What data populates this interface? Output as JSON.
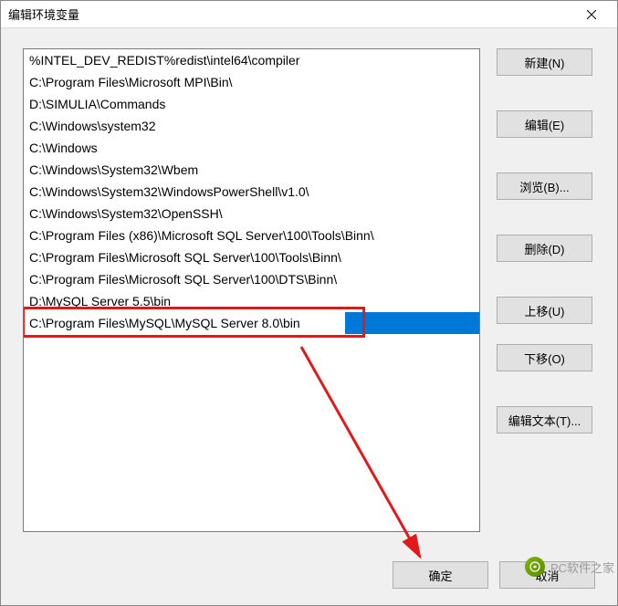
{
  "window": {
    "title": "编辑环境变量"
  },
  "list": {
    "items": [
      "%INTEL_DEV_REDIST%redist\\intel64\\compiler",
      "C:\\Program Files\\Microsoft MPI\\Bin\\",
      "D:\\SIMULIA\\Commands",
      "C:\\Windows\\system32",
      "C:\\Windows",
      "C:\\Windows\\System32\\Wbem",
      "C:\\Windows\\System32\\WindowsPowerShell\\v1.0\\",
      "C:\\Windows\\System32\\OpenSSH\\",
      "C:\\Program Files (x86)\\Microsoft SQL Server\\100\\Tools\\Binn\\",
      "C:\\Program Files\\Microsoft SQL Server\\100\\Tools\\Binn\\",
      "C:\\Program Files\\Microsoft SQL Server\\100\\DTS\\Binn\\",
      "D:\\MySQL Server 5.5\\bin",
      "C:\\Program Files\\MySQL\\MySQL Server 8.0\\bin"
    ],
    "selectedIndex": 12,
    "editValue": "C:\\Program Files\\MySQL\\MySQL Server 8.0\\bin"
  },
  "buttons": {
    "new": "新建(N)",
    "edit": "编辑(E)",
    "browse": "浏览(B)...",
    "delete": "删除(D)",
    "moveUp": "上移(U)",
    "moveDown": "下移(O)",
    "editText": "编辑文本(T)..."
  },
  "footer": {
    "ok": "确定",
    "cancel": "取消"
  },
  "watermark": {
    "text": "PC软件之家"
  }
}
